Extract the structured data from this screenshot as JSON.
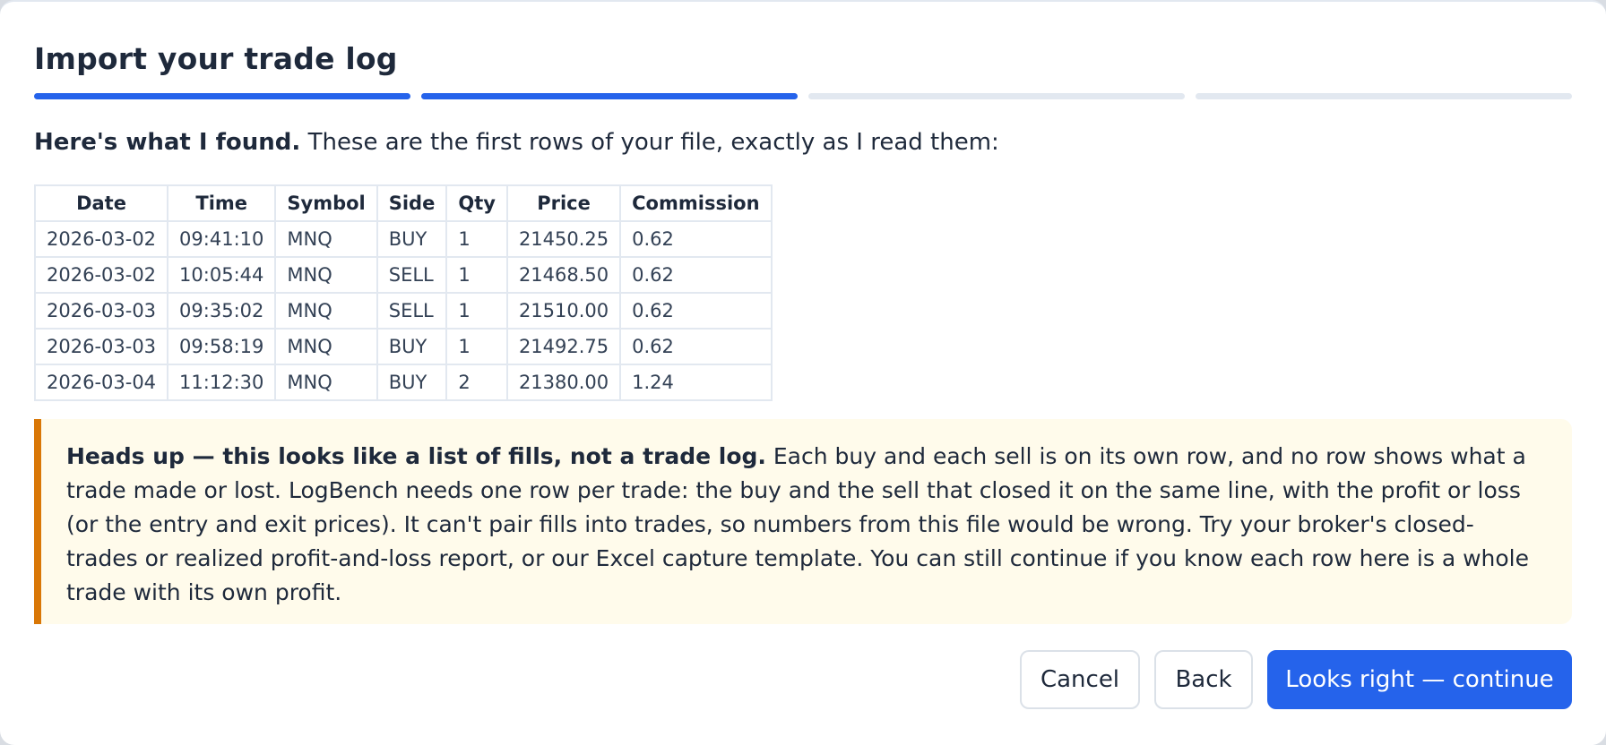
{
  "dialog": {
    "title": "Import your trade log",
    "steps": [
      {
        "state": "done"
      },
      {
        "state": "done"
      },
      {
        "state": "pending"
      },
      {
        "state": "pending"
      }
    ]
  },
  "intro": {
    "bold": "Here's what I found.",
    "text": " These are the first rows of your file, exactly as I read them:"
  },
  "table": {
    "headers": [
      "Date",
      "Time",
      "Symbol",
      "Side",
      "Qty",
      "Price",
      "Commission"
    ],
    "rows": [
      [
        "2026-03-02",
        "09:41:10",
        "MNQ",
        "BUY",
        "1",
        "21450.25",
        "0.62"
      ],
      [
        "2026-03-02",
        "10:05:44",
        "MNQ",
        "SELL",
        "1",
        "21468.50",
        "0.62"
      ],
      [
        "2026-03-03",
        "09:35:02",
        "MNQ",
        "SELL",
        "1",
        "21510.00",
        "0.62"
      ],
      [
        "2026-03-03",
        "09:58:19",
        "MNQ",
        "BUY",
        "1",
        "21492.75",
        "0.62"
      ],
      [
        "2026-03-04",
        "11:12:30",
        "MNQ",
        "BUY",
        "2",
        "21380.00",
        "1.24"
      ]
    ]
  },
  "notice": {
    "bold": "Heads up — this looks like a list of fills, not a trade log.",
    "text": " Each buy and each sell is on its own row, and no row shows what a trade made or lost. LogBench needs one row per trade: the buy and the sell that closed it on the same line, with the profit or loss (or the entry and exit prices). It can't pair fills into trades, so numbers from this file would be wrong. Try your broker's closed-trades or realized profit-and-loss report, or our Excel capture template. You can still continue if you know each row here is a whole trade with its own profit."
  },
  "buttons": {
    "cancel": "Cancel",
    "back": "Back",
    "continue": "Looks right — continue"
  },
  "colors": {
    "accent": "#2563eb",
    "warning_border": "#d97706",
    "warning_bg": "#fffbeb"
  }
}
